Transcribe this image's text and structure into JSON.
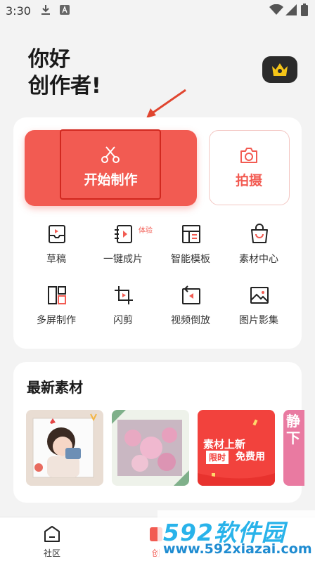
{
  "status_bar": {
    "time": "3:30",
    "icons": [
      "download-icon",
      "a-notification-icon",
      "wifi-icon",
      "signal-icon",
      "battery-icon"
    ]
  },
  "greeting": {
    "line1": "你好",
    "line2": "创作者!"
  },
  "vip_icon": "crown-icon",
  "actions": {
    "start": "开始制作",
    "shoot": "拍摄"
  },
  "tools": [
    {
      "label": "草稿",
      "icon": "inbox-icon"
    },
    {
      "label": "一键成片",
      "icon": "video-file-icon",
      "badge": "体验"
    },
    {
      "label": "智能模板",
      "icon": "template-icon"
    },
    {
      "label": "素材中心",
      "icon": "shopping-bag-icon"
    },
    {
      "label": "多屏制作",
      "icon": "multi-screen-icon"
    },
    {
      "label": "闪剪",
      "icon": "crop-icon"
    },
    {
      "label": "视频倒放",
      "icon": "reverse-play-icon"
    },
    {
      "label": "图片影集",
      "icon": "image-icon"
    }
  ],
  "materials": {
    "title": "最新素材",
    "promo_line1": "素材上新",
    "promo_tag": "限时",
    "promo_line2": "免费用",
    "partial_chars": "静下"
  },
  "bottom_nav": [
    {
      "label": "社区",
      "icon": "community-icon"
    },
    {
      "label": "创",
      "icon": "create-icon"
    }
  ],
  "watermark": {
    "line1": "592软件园",
    "line2": "www.592xiazai.com"
  },
  "colors": {
    "accent": "#f25b52",
    "background": "#f3f3f3",
    "card": "#ffffff"
  }
}
